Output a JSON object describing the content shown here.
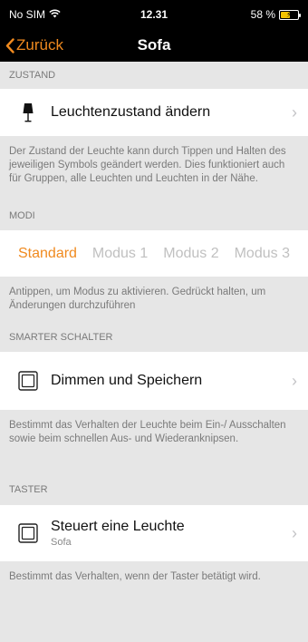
{
  "status_bar": {
    "carrier": "No SIM",
    "time": "12.31",
    "battery_percent": "58 %",
    "battery_level": 0.58,
    "battery_color": "#f2c200",
    "icons": [
      "wifi-icon",
      "battery-charging-icon"
    ]
  },
  "nav": {
    "back_label": "Zurück",
    "title": "Sofa",
    "accent_color": "#f08a1f"
  },
  "sections": {
    "zustand": {
      "header": "ZUSTAND",
      "row_label": "Leuchtenzustand ändern",
      "row_icon": "lamp-icon",
      "description": "Der Zustand der Leuchte kann durch Tippen und Halten des jeweiligen Symbols geändert werden. Dies funktioniert auch für Gruppen, alle Leuchten und Leuchten in der Nähe."
    },
    "modi": {
      "header": "MODI",
      "modes": [
        "Standard",
        "Modus 1",
        "Modus 2",
        "Modus 3"
      ],
      "selected": "Standard",
      "description": "Antippen, um Modus zu aktivieren. Gedrückt halten, um Änderungen durchzuführen"
    },
    "smarter_schalter": {
      "header": "SMARTER SCHALTER",
      "row_label": "Dimmen und Speichern",
      "row_icon": "switch-icon",
      "description": "Bestimmt das Verhalten der Leuchte beim Ein-/ Ausschalten sowie beim schnellen Aus- und Wiederanknipsen."
    },
    "taster": {
      "header": "TASTER",
      "row_label": "Steuert eine Leuchte",
      "row_sublabel": "Sofa",
      "row_icon": "switch-icon",
      "description": "Bestimmt das Verhalten, wenn der Taster betätigt wird."
    }
  }
}
